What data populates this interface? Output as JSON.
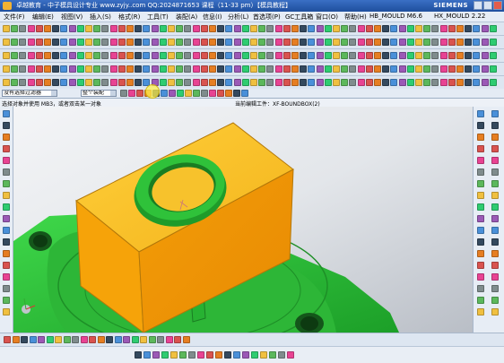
{
  "window": {
    "title": "卓越教育 - 中子模具设计专业 www.zyjy..com  QQ:2024871653  课程（11-33 pm）【模具教程】",
    "brand": "SIEMENS"
  },
  "menu": {
    "items": [
      "文件(F)",
      "编辑(E)",
      "视图(V)",
      "插入(S)",
      "格式(R)",
      "工具(T)",
      "装配(A)",
      "信息(I)",
      "分析(L)",
      "首选项(P)",
      "GC工具箱",
      "窗口(O)",
      "帮助(H)",
      "HB_MOULD M6.6",
      "HX_MOULD 2.22"
    ]
  },
  "selection_bar": {
    "filter_value": "没有选择过滤器",
    "scope_value": "整个装配"
  },
  "cue_line": {
    "prompt": "选择对象并使用 MB3，或者双击某一对象",
    "status": "当前编辑工件：XF-BOUNDBOX(2)"
  },
  "colors": {
    "title_bar": "#1f4f9d",
    "toolbar_bg": "#dde6f1",
    "part_orange": "#f5a50b",
    "part_green": "#2fc23a",
    "viewport_bg": "#dfe3e8"
  },
  "icons": {
    "toolbar_row_1": "standard-icons",
    "toolbar_row_2": "feature-icons",
    "toolbar_row_3": "mold-tool-icons",
    "toolbar_row_4": "mold-wizard-icons",
    "toolbar_row_5": "analysis-icons",
    "right_resource_bar": "resource-bar-icons",
    "left_bar": "navigator-icons",
    "bottom_bar": "snap-point-icons"
  }
}
